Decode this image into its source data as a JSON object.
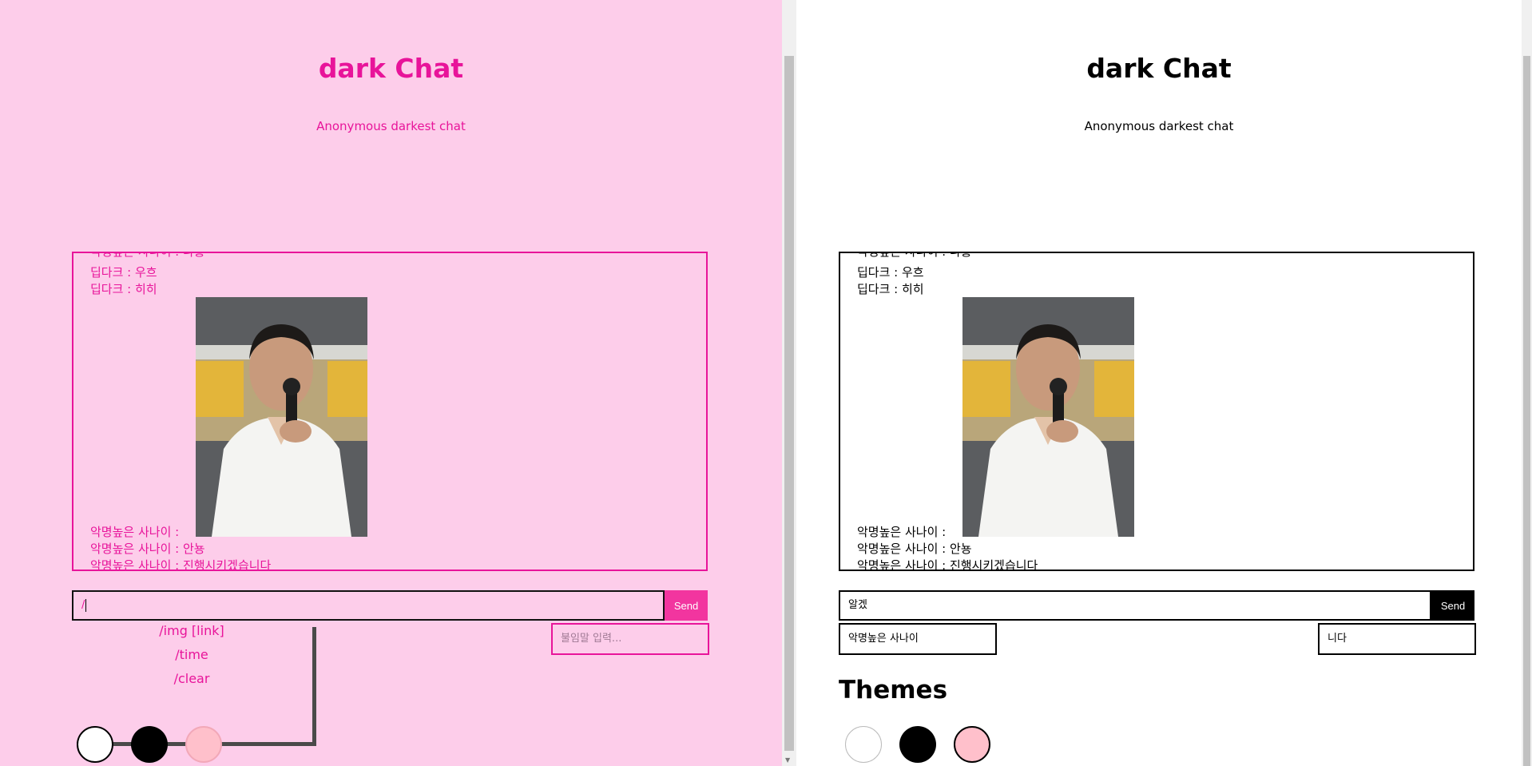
{
  "left": {
    "title": "dark Chat",
    "subtitle": "Anonymous darkest chat",
    "messages": [
      "악명높은 사나이 : 나홍",
      "딥다크 : 우흐",
      "딥다크 : 히히",
      "악명높은 사나이 :",
      "악명높은 사나이 : 안뇽",
      "악명높은 사나이 : 진행시키겠습니다"
    ],
    "input_value": "/",
    "send_label": "Send",
    "nickname_placeholder": "불임말 입력...",
    "commands": [
      "/img [link]",
      "/time",
      "/clear"
    ],
    "theme_colors": [
      "#ffffff",
      "#000000",
      "#ffc0cb"
    ]
  },
  "right": {
    "title": "dark Chat",
    "subtitle": "Anonymous darkest chat",
    "messages": [
      "악명높은 사나이 : 나홍",
      "딥다크 : 우흐",
      "딥다크 : 히히",
      "악명높은 사나이 :",
      "악명높은 사나이 : 안뇽",
      "악명높은 사나이 : 진행시키겠습니다"
    ],
    "input_value": "알겠",
    "send_label": "Send",
    "nickname_value": "악명높은 사나이",
    "suffix_value": "니다",
    "themes_heading": "Themes",
    "theme_colors": [
      "#ffffff",
      "#000000",
      "#ffc0cb"
    ]
  },
  "colors": {
    "pink_bg": "#fdcdea",
    "pink_accent": "#e8149a",
    "send_pink": "#f2359f"
  }
}
